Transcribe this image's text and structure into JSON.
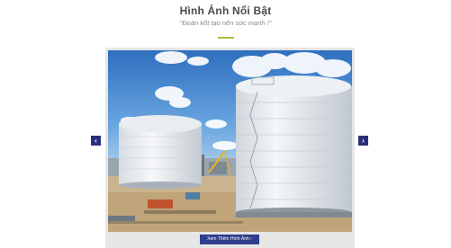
{
  "section": {
    "title": "Hình Ảnh Nổi Bật",
    "subtitle": "\"Đoàn kết tạo nên sức mạnh !\""
  },
  "slider": {
    "image_alt": "Bồn chứa",
    "prev_icon": "chevron-left-icon",
    "next_icon": "chevron-right-icon",
    "prev_glyph": "‹",
    "next_glyph": "›",
    "more_button_label": "Xem Thêm Hình Ảnh ›"
  },
  "colors": {
    "accent": "#a4c046",
    "nav": "#2a2f7a",
    "button": "#2f3e8c"
  }
}
